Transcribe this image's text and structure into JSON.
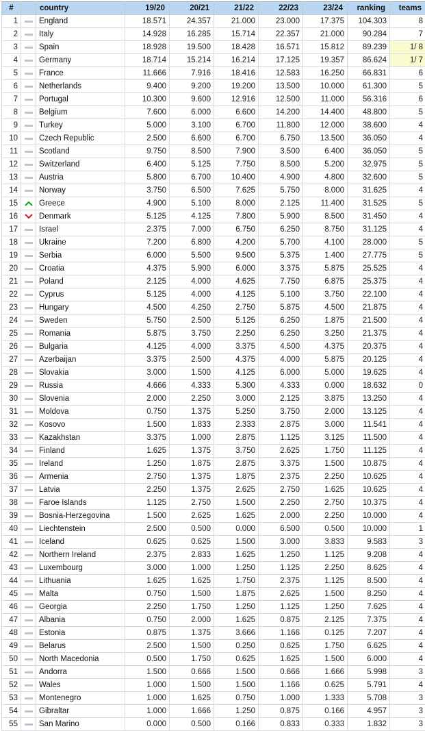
{
  "table": {
    "name": "uefa-country-coefficient-ranking",
    "columns": [
      {
        "key": "rank",
        "label": "#",
        "align": "center"
      },
      {
        "key": "move",
        "label": "",
        "align": "center"
      },
      {
        "key": "country",
        "label": "country",
        "align": "left"
      },
      {
        "key": "s1920",
        "label": "19/20",
        "align": "right"
      },
      {
        "key": "s2021",
        "label": "20/21",
        "align": "right"
      },
      {
        "key": "s2122",
        "label": "21/22",
        "align": "right"
      },
      {
        "key": "s2223",
        "label": "22/23",
        "align": "right"
      },
      {
        "key": "s2324",
        "label": "23/24",
        "align": "right"
      },
      {
        "key": "ranking",
        "label": "ranking",
        "align": "right"
      },
      {
        "key": "teams",
        "label": "teams",
        "align": "right"
      }
    ],
    "colors": {
      "header_bg": "#b9d7f2",
      "row_bg": "#ffffff",
      "highlight_bg": "#fbfbd0",
      "border": "#d5d9dd",
      "move_up": "#14a014",
      "move_down": "#d11f1f",
      "move_same": "#c0c4c8"
    },
    "icons": {
      "same": "dash-icon",
      "up": "chevron-up-icon",
      "down": "chevron-down-icon"
    },
    "rows": [
      {
        "rank": "1",
        "move": "same",
        "country": "England",
        "s1920": "18.571",
        "s2021": "24.357",
        "s2122": "21.000",
        "s2223": "23.000",
        "s2324": "17.375",
        "ranking": "104.303",
        "teams": "8",
        "teams_highlight": false
      },
      {
        "rank": "2",
        "move": "same",
        "country": "Italy",
        "s1920": "14.928",
        "s2021": "16.285",
        "s2122": "15.714",
        "s2223": "22.357",
        "s2324": "21.000",
        "ranking": "90.284",
        "teams": "7",
        "teams_highlight": false
      },
      {
        "rank": "3",
        "move": "same",
        "country": "Spain",
        "s1920": "18.928",
        "s2021": "19.500",
        "s2122": "18.428",
        "s2223": "16.571",
        "s2324": "15.812",
        "ranking": "89.239",
        "teams": "1/ 8",
        "teams_highlight": true
      },
      {
        "rank": "4",
        "move": "same",
        "country": "Germany",
        "s1920": "18.714",
        "s2021": "15.214",
        "s2122": "16.214",
        "s2223": "17.125",
        "s2324": "19.357",
        "ranking": "86.624",
        "teams": "1/ 7",
        "teams_highlight": true
      },
      {
        "rank": "5",
        "move": "same",
        "country": "France",
        "s1920": "11.666",
        "s2021": "7.916",
        "s2122": "18.416",
        "s2223": "12.583",
        "s2324": "16.250",
        "ranking": "66.831",
        "teams": "6",
        "teams_highlight": false
      },
      {
        "rank": "6",
        "move": "same",
        "country": "Netherlands",
        "s1920": "9.400",
        "s2021": "9.200",
        "s2122": "19.200",
        "s2223": "13.500",
        "s2324": "10.000",
        "ranking": "61.300",
        "teams": "5",
        "teams_highlight": false
      },
      {
        "rank": "7",
        "move": "same",
        "country": "Portugal",
        "s1920": "10.300",
        "s2021": "9.600",
        "s2122": "12.916",
        "s2223": "12.500",
        "s2324": "11.000",
        "ranking": "56.316",
        "teams": "6",
        "teams_highlight": false
      },
      {
        "rank": "8",
        "move": "same",
        "country": "Belgium",
        "s1920": "7.600",
        "s2021": "6.000",
        "s2122": "6.600",
        "s2223": "14.200",
        "s2324": "14.400",
        "ranking": "48.800",
        "teams": "5",
        "teams_highlight": false
      },
      {
        "rank": "9",
        "move": "same",
        "country": "Turkey",
        "s1920": "5.000",
        "s2021": "3.100",
        "s2122": "6.700",
        "s2223": "11.800",
        "s2324": "12.000",
        "ranking": "38.600",
        "teams": "4",
        "teams_highlight": false
      },
      {
        "rank": "10",
        "move": "same",
        "country": "Czech Republic",
        "s1920": "2.500",
        "s2021": "6.600",
        "s2122": "6.700",
        "s2223": "6.750",
        "s2324": "13.500",
        "ranking": "36.050",
        "teams": "4",
        "teams_highlight": false
      },
      {
        "rank": "11",
        "move": "same",
        "country": "Scotland",
        "s1920": "9.750",
        "s2021": "8.500",
        "s2122": "7.900",
        "s2223": "3.500",
        "s2324": "6.400",
        "ranking": "36.050",
        "teams": "5",
        "teams_highlight": false
      },
      {
        "rank": "12",
        "move": "same",
        "country": "Switzerland",
        "s1920": "6.400",
        "s2021": "5.125",
        "s2122": "7.750",
        "s2223": "8.500",
        "s2324": "5.200",
        "ranking": "32.975",
        "teams": "5",
        "teams_highlight": false
      },
      {
        "rank": "13",
        "move": "same",
        "country": "Austria",
        "s1920": "5.800",
        "s2021": "6.700",
        "s2122": "10.400",
        "s2223": "4.900",
        "s2324": "4.800",
        "ranking": "32.600",
        "teams": "5",
        "teams_highlight": false
      },
      {
        "rank": "14",
        "move": "same",
        "country": "Norway",
        "s1920": "3.750",
        "s2021": "6.500",
        "s2122": "7.625",
        "s2223": "5.750",
        "s2324": "8.000",
        "ranking": "31.625",
        "teams": "4",
        "teams_highlight": false
      },
      {
        "rank": "15",
        "move": "up",
        "country": "Greece",
        "s1920": "4.900",
        "s2021": "5.100",
        "s2122": "8.000",
        "s2223": "2.125",
        "s2324": "11.400",
        "ranking": "31.525",
        "teams": "5",
        "teams_highlight": false
      },
      {
        "rank": "16",
        "move": "down",
        "country": "Denmark",
        "s1920": "5.125",
        "s2021": "4.125",
        "s2122": "7.800",
        "s2223": "5.900",
        "s2324": "8.500",
        "ranking": "31.450",
        "teams": "4",
        "teams_highlight": false
      },
      {
        "rank": "17",
        "move": "same",
        "country": "Israel",
        "s1920": "2.375",
        "s2021": "7.000",
        "s2122": "6.750",
        "s2223": "6.250",
        "s2324": "8.750",
        "ranking": "31.125",
        "teams": "4",
        "teams_highlight": false
      },
      {
        "rank": "18",
        "move": "same",
        "country": "Ukraine",
        "s1920": "7.200",
        "s2021": "6.800",
        "s2122": "4.200",
        "s2223": "5.700",
        "s2324": "4.100",
        "ranking": "28.000",
        "teams": "5",
        "teams_highlight": false
      },
      {
        "rank": "19",
        "move": "same",
        "country": "Serbia",
        "s1920": "6.000",
        "s2021": "5.500",
        "s2122": "9.500",
        "s2223": "5.375",
        "s2324": "1.400",
        "ranking": "27.775",
        "teams": "5",
        "teams_highlight": false
      },
      {
        "rank": "20",
        "move": "same",
        "country": "Croatia",
        "s1920": "4.375",
        "s2021": "5.900",
        "s2122": "6.000",
        "s2223": "3.375",
        "s2324": "5.875",
        "ranking": "25.525",
        "teams": "4",
        "teams_highlight": false
      },
      {
        "rank": "21",
        "move": "same",
        "country": "Poland",
        "s1920": "2.125",
        "s2021": "4.000",
        "s2122": "4.625",
        "s2223": "7.750",
        "s2324": "6.875",
        "ranking": "25.375",
        "teams": "4",
        "teams_highlight": false
      },
      {
        "rank": "22",
        "move": "same",
        "country": "Cyprus",
        "s1920": "5.125",
        "s2021": "4.000",
        "s2122": "4.125",
        "s2223": "5.100",
        "s2324": "3.750",
        "ranking": "22.100",
        "teams": "4",
        "teams_highlight": false
      },
      {
        "rank": "23",
        "move": "same",
        "country": "Hungary",
        "s1920": "4.500",
        "s2021": "4.250",
        "s2122": "2.750",
        "s2223": "5.875",
        "s2324": "4.500",
        "ranking": "21.875",
        "teams": "4",
        "teams_highlight": false
      },
      {
        "rank": "24",
        "move": "same",
        "country": "Sweden",
        "s1920": "5.750",
        "s2021": "2.500",
        "s2122": "5.125",
        "s2223": "6.250",
        "s2324": "1.875",
        "ranking": "21.500",
        "teams": "4",
        "teams_highlight": false
      },
      {
        "rank": "25",
        "move": "same",
        "country": "Romania",
        "s1920": "5.875",
        "s2021": "3.750",
        "s2122": "2.250",
        "s2223": "6.250",
        "s2324": "3.250",
        "ranking": "21.375",
        "teams": "4",
        "teams_highlight": false
      },
      {
        "rank": "26",
        "move": "same",
        "country": "Bulgaria",
        "s1920": "4.125",
        "s2021": "4.000",
        "s2122": "3.375",
        "s2223": "4.500",
        "s2324": "4.375",
        "ranking": "20.375",
        "teams": "4",
        "teams_highlight": false
      },
      {
        "rank": "27",
        "move": "same",
        "country": "Azerbaijan",
        "s1920": "3.375",
        "s2021": "2.500",
        "s2122": "4.375",
        "s2223": "4.000",
        "s2324": "5.875",
        "ranking": "20.125",
        "teams": "4",
        "teams_highlight": false
      },
      {
        "rank": "28",
        "move": "same",
        "country": "Slovakia",
        "s1920": "3.000",
        "s2021": "1.500",
        "s2122": "4.125",
        "s2223": "6.000",
        "s2324": "5.000",
        "ranking": "19.625",
        "teams": "4",
        "teams_highlight": false
      },
      {
        "rank": "29",
        "move": "same",
        "country": "Russia",
        "s1920": "4.666",
        "s2021": "4.333",
        "s2122": "5.300",
        "s2223": "4.333",
        "s2324": "0.000",
        "ranking": "18.632",
        "teams": "0",
        "teams_highlight": false
      },
      {
        "rank": "30",
        "move": "same",
        "country": "Slovenia",
        "s1920": "2.000",
        "s2021": "2.250",
        "s2122": "3.000",
        "s2223": "2.125",
        "s2324": "3.875",
        "ranking": "13.250",
        "teams": "4",
        "teams_highlight": false
      },
      {
        "rank": "31",
        "move": "same",
        "country": "Moldova",
        "s1920": "0.750",
        "s2021": "1.375",
        "s2122": "5.250",
        "s2223": "3.750",
        "s2324": "2.000",
        "ranking": "13.125",
        "teams": "4",
        "teams_highlight": false
      },
      {
        "rank": "32",
        "move": "same",
        "country": "Kosovo",
        "s1920": "1.500",
        "s2021": "1.833",
        "s2122": "2.333",
        "s2223": "2.875",
        "s2324": "3.000",
        "ranking": "11.541",
        "teams": "4",
        "teams_highlight": false
      },
      {
        "rank": "33",
        "move": "same",
        "country": "Kazakhstan",
        "s1920": "3.375",
        "s2021": "1.000",
        "s2122": "2.875",
        "s2223": "1.125",
        "s2324": "3.125",
        "ranking": "11.500",
        "teams": "4",
        "teams_highlight": false
      },
      {
        "rank": "34",
        "move": "same",
        "country": "Finland",
        "s1920": "1.625",
        "s2021": "1.375",
        "s2122": "3.750",
        "s2223": "2.625",
        "s2324": "1.750",
        "ranking": "11.125",
        "teams": "4",
        "teams_highlight": false
      },
      {
        "rank": "35",
        "move": "same",
        "country": "Ireland",
        "s1920": "1.250",
        "s2021": "1.875",
        "s2122": "2.875",
        "s2223": "3.375",
        "s2324": "1.500",
        "ranking": "10.875",
        "teams": "4",
        "teams_highlight": false
      },
      {
        "rank": "36",
        "move": "same",
        "country": "Armenia",
        "s1920": "2.750",
        "s2021": "1.375",
        "s2122": "1.875",
        "s2223": "2.375",
        "s2324": "2.250",
        "ranking": "10.625",
        "teams": "4",
        "teams_highlight": false
      },
      {
        "rank": "37",
        "move": "same",
        "country": "Latvia",
        "s1920": "2.250",
        "s2021": "1.375",
        "s2122": "2.625",
        "s2223": "2.750",
        "s2324": "1.625",
        "ranking": "10.625",
        "teams": "4",
        "teams_highlight": false
      },
      {
        "rank": "38",
        "move": "same",
        "country": "Faroe Islands",
        "s1920": "1.125",
        "s2021": "2.750",
        "s2122": "1.500",
        "s2223": "2.250",
        "s2324": "2.750",
        "ranking": "10.375",
        "teams": "4",
        "teams_highlight": false
      },
      {
        "rank": "39",
        "move": "same",
        "country": "Bosnia-Herzegovina",
        "s1920": "1.500",
        "s2021": "2.625",
        "s2122": "1.625",
        "s2223": "2.000",
        "s2324": "2.250",
        "ranking": "10.000",
        "teams": "4",
        "teams_highlight": false
      },
      {
        "rank": "40",
        "move": "same",
        "country": "Liechtenstein",
        "s1920": "2.500",
        "s2021": "0.500",
        "s2122": "0.000",
        "s2223": "6.500",
        "s2324": "0.500",
        "ranking": "10.000",
        "teams": "1",
        "teams_highlight": false
      },
      {
        "rank": "41",
        "move": "same",
        "country": "Iceland",
        "s1920": "0.625",
        "s2021": "0.625",
        "s2122": "1.500",
        "s2223": "3.000",
        "s2324": "3.833",
        "ranking": "9.583",
        "teams": "3",
        "teams_highlight": false
      },
      {
        "rank": "42",
        "move": "same",
        "country": "Northern Ireland",
        "s1920": "2.375",
        "s2021": "2.833",
        "s2122": "1.625",
        "s2223": "1.250",
        "s2324": "1.125",
        "ranking": "9.208",
        "teams": "4",
        "teams_highlight": false
      },
      {
        "rank": "43",
        "move": "same",
        "country": "Luxembourg",
        "s1920": "3.000",
        "s2021": "1.000",
        "s2122": "1.250",
        "s2223": "1.125",
        "s2324": "2.250",
        "ranking": "8.625",
        "teams": "4",
        "teams_highlight": false
      },
      {
        "rank": "44",
        "move": "same",
        "country": "Lithuania",
        "s1920": "1.625",
        "s2021": "1.625",
        "s2122": "1.750",
        "s2223": "2.375",
        "s2324": "1.125",
        "ranking": "8.500",
        "teams": "4",
        "teams_highlight": false
      },
      {
        "rank": "45",
        "move": "same",
        "country": "Malta",
        "s1920": "0.750",
        "s2021": "1.500",
        "s2122": "1.875",
        "s2223": "2.625",
        "s2324": "1.500",
        "ranking": "8.250",
        "teams": "4",
        "teams_highlight": false
      },
      {
        "rank": "46",
        "move": "same",
        "country": "Georgia",
        "s1920": "2.250",
        "s2021": "1.750",
        "s2122": "1.250",
        "s2223": "1.125",
        "s2324": "1.250",
        "ranking": "7.625",
        "teams": "4",
        "teams_highlight": false
      },
      {
        "rank": "47",
        "move": "same",
        "country": "Albania",
        "s1920": "0.750",
        "s2021": "2.000",
        "s2122": "1.625",
        "s2223": "0.875",
        "s2324": "2.125",
        "ranking": "7.375",
        "teams": "4",
        "teams_highlight": false
      },
      {
        "rank": "48",
        "move": "same",
        "country": "Estonia",
        "s1920": "0.875",
        "s2021": "1.375",
        "s2122": "3.666",
        "s2223": "1.166",
        "s2324": "0.125",
        "ranking": "7.207",
        "teams": "4",
        "teams_highlight": false
      },
      {
        "rank": "49",
        "move": "same",
        "country": "Belarus",
        "s1920": "2.500",
        "s2021": "1.500",
        "s2122": "0.250",
        "s2223": "0.625",
        "s2324": "1.750",
        "ranking": "6.625",
        "teams": "4",
        "teams_highlight": false
      },
      {
        "rank": "50",
        "move": "same",
        "country": "North Macedonia",
        "s1920": "0.500",
        "s2021": "1.750",
        "s2122": "0.625",
        "s2223": "1.625",
        "s2324": "1.500",
        "ranking": "6.000",
        "teams": "4",
        "teams_highlight": false
      },
      {
        "rank": "51",
        "move": "same",
        "country": "Andorra",
        "s1920": "1.500",
        "s2021": "0.666",
        "s2122": "1.500",
        "s2223": "0.666",
        "s2324": "1.666",
        "ranking": "5.998",
        "teams": "3",
        "teams_highlight": false
      },
      {
        "rank": "52",
        "move": "same",
        "country": "Wales",
        "s1920": "1.000",
        "s2021": "1.500",
        "s2122": "1.500",
        "s2223": "1.166",
        "s2324": "0.625",
        "ranking": "5.791",
        "teams": "4",
        "teams_highlight": false
      },
      {
        "rank": "53",
        "move": "same",
        "country": "Montenegro",
        "s1920": "1.000",
        "s2021": "1.625",
        "s2122": "0.750",
        "s2223": "1.000",
        "s2324": "1.333",
        "ranking": "5.708",
        "teams": "3",
        "teams_highlight": false
      },
      {
        "rank": "54",
        "move": "same",
        "country": "Gibraltar",
        "s1920": "1.000",
        "s2021": "1.666",
        "s2122": "1.250",
        "s2223": "0.875",
        "s2324": "0.166",
        "ranking": "4.957",
        "teams": "3",
        "teams_highlight": false
      },
      {
        "rank": "55",
        "move": "same",
        "country": "San Marino",
        "s1920": "0.000",
        "s2021": "0.500",
        "s2122": "0.166",
        "s2223": "0.833",
        "s2324": "0.333",
        "ranking": "1.832",
        "teams": "3",
        "teams_highlight": false
      }
    ]
  }
}
